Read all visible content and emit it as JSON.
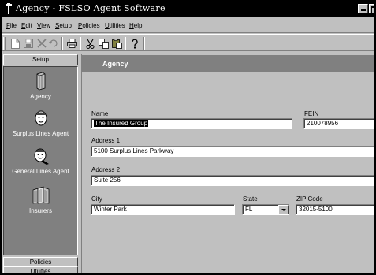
{
  "window": {
    "title": "Agency - FSLSO Agent Software"
  },
  "menu": [
    "File",
    "Edit",
    "View",
    "Setup",
    "Policies",
    "Utilities",
    "Help"
  ],
  "toolbar": [
    "new-icon",
    "save-icon",
    "delete-icon",
    "undo-icon",
    "print-icon",
    "cut-icon",
    "copy-icon",
    "paste-icon",
    "help-icon"
  ],
  "nav": {
    "top_button": "Setup",
    "items": [
      {
        "label": "Agency",
        "icon": "agency-icon"
      },
      {
        "label": "Surplus Lines Agent",
        "icon": "surplus-lines-agent-icon"
      },
      {
        "label": "General Lines Agent",
        "icon": "general-lines-agent-icon"
      },
      {
        "label": "Insurers",
        "icon": "insurers-icon"
      }
    ],
    "bottom_buttons": [
      "Policies",
      "Utilities"
    ]
  },
  "form": {
    "header": "Agency",
    "name_label": "Name",
    "name_value": "The Insured Group",
    "fein_label": "FEIN",
    "fein_value": "210078956",
    "address1_label": "Address 1",
    "address1_value": "5100 Surplus Lines Parkway",
    "address2_label": "Address 2",
    "address2_value": "Suite 256",
    "city_label": "City",
    "city_value": "Winter Park",
    "state_label": "State",
    "state_value": "FL",
    "zip_label": "ZIP Code",
    "zip_value": "32015-5100"
  }
}
